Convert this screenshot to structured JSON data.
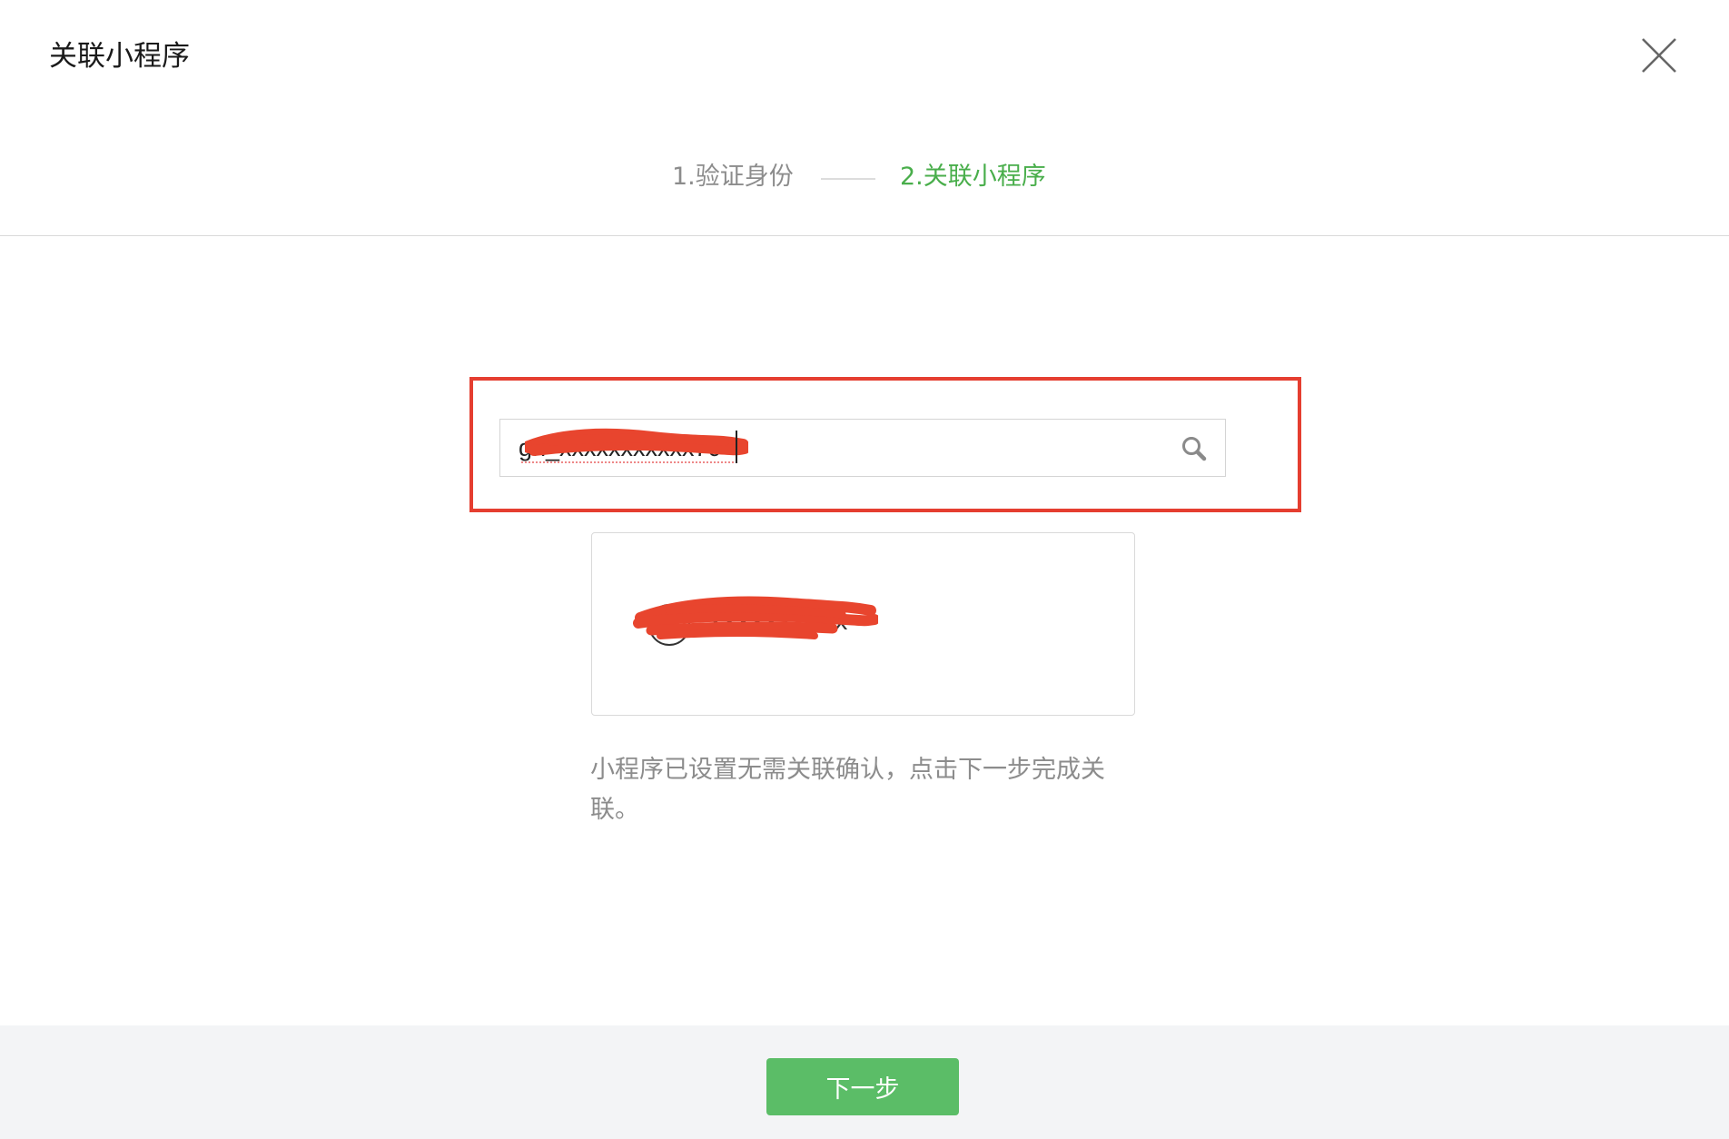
{
  "dialog": {
    "title": "关联小程序"
  },
  "steps": [
    {
      "label": "1.验证身份",
      "state": "done"
    },
    {
      "label": "2.关联小程序",
      "state": "active"
    }
  ],
  "search": {
    "value": "gh_xxxxxxxxxxx7c",
    "icon": "search-icon"
  },
  "result": {
    "name": "xxxxxxxxxx"
  },
  "hint": "小程序已设置无需关联确认，点击下一步完成关联。",
  "footer": {
    "next_label": "下一步"
  },
  "colors": {
    "accent_green": "#49ae4b",
    "button_green": "#5bbd67",
    "highlight_red": "#e53e30",
    "footer_bg": "#f3f4f6"
  }
}
